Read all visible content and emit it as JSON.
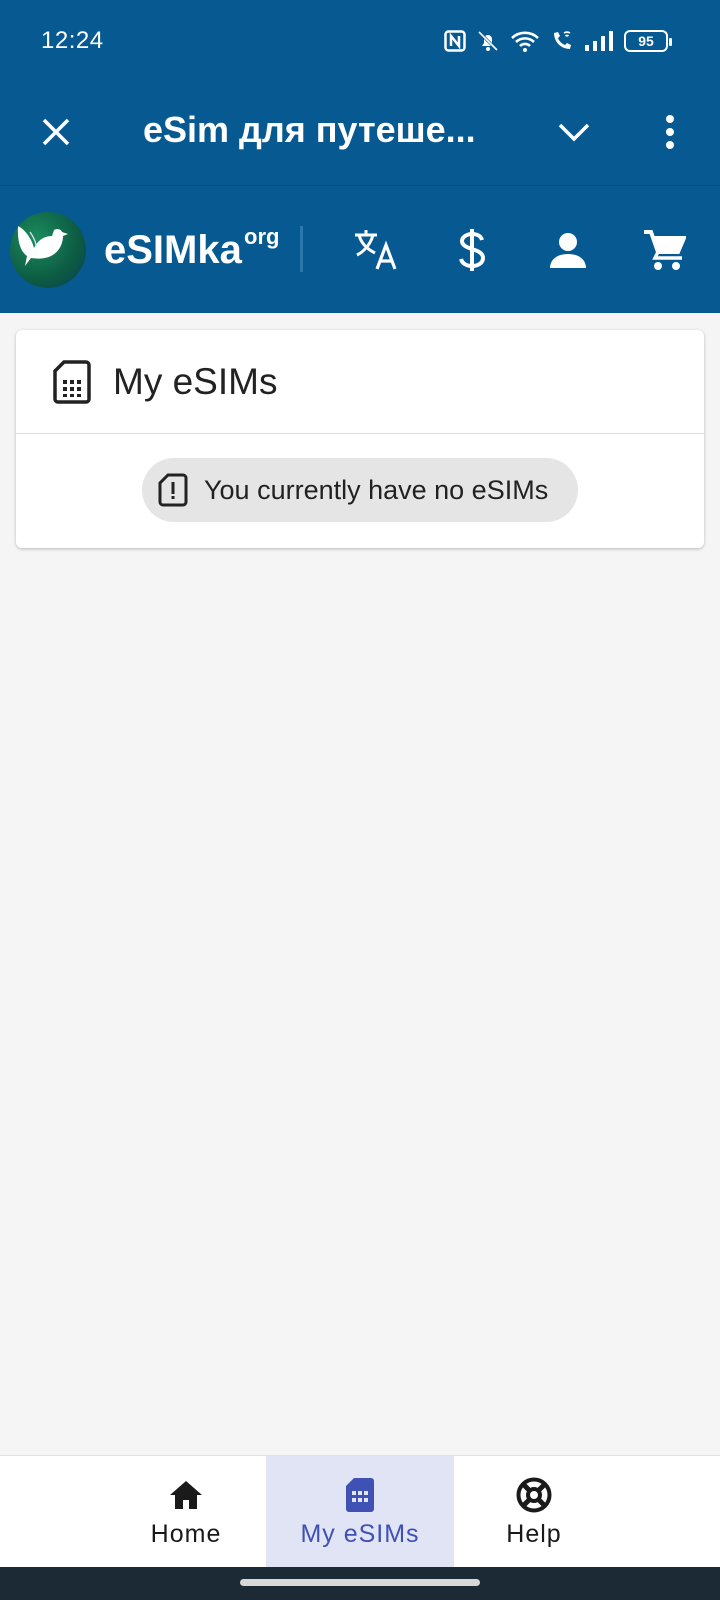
{
  "status_bar": {
    "time": "12:24",
    "battery": "95",
    "icons": [
      "nfc-icon",
      "bell-off-icon",
      "wifi-icon",
      "wifi-call-icon",
      "signal-icon",
      "battery-icon"
    ]
  },
  "app_bar": {
    "title": "eSim для путеше..."
  },
  "site_header": {
    "brand": "eSIMka",
    "brand_suffix": "org"
  },
  "card": {
    "title": "My eSIMs",
    "empty_message": "You currently have no eSIMs"
  },
  "bottom_nav": {
    "items": [
      {
        "label": "Home",
        "icon": "home-icon",
        "active": false
      },
      {
        "label": "My eSIMs",
        "icon": "sim-card-icon",
        "active": true
      },
      {
        "label": "Help",
        "icon": "lifebuoy-icon",
        "active": false
      }
    ]
  },
  "colors": {
    "primary": "#065a91",
    "active_nav_bg": "#e0e4f5",
    "active_nav_text": "#3f51b5",
    "page_bg": "#f5f5f5"
  }
}
